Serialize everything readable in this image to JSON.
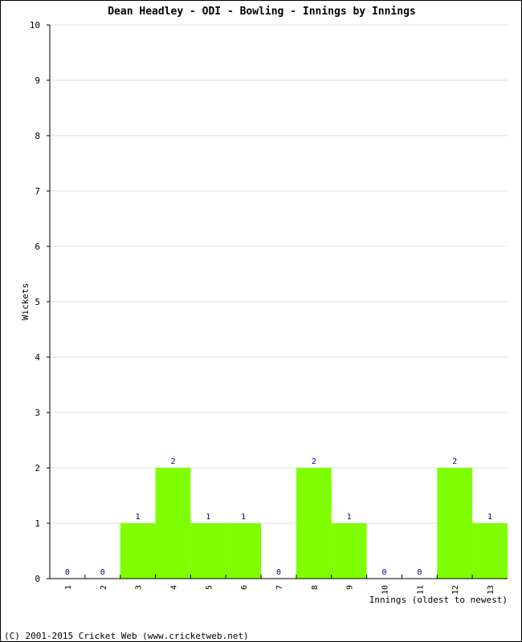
{
  "chart_data": {
    "type": "bar",
    "title": "Dean Headley - ODI - Bowling - Innings by Innings",
    "xlabel": "Innings (oldest to newest)",
    "ylabel": "Wickets",
    "categories": [
      "1",
      "2",
      "3",
      "4",
      "5",
      "6",
      "7",
      "8",
      "9",
      "10",
      "11",
      "12",
      "13"
    ],
    "values": [
      0,
      0,
      1,
      2,
      1,
      1,
      0,
      2,
      1,
      0,
      0,
      2,
      1
    ],
    "ylim": [
      0,
      10
    ],
    "yticks": [
      0,
      1,
      2,
      3,
      4,
      5,
      6,
      7,
      8,
      9,
      10
    ],
    "grid": true,
    "bar_color": "#80ff00",
    "label_color": "#000099"
  },
  "footer": "(C) 2001-2015 Cricket Web (www.cricketweb.net)"
}
